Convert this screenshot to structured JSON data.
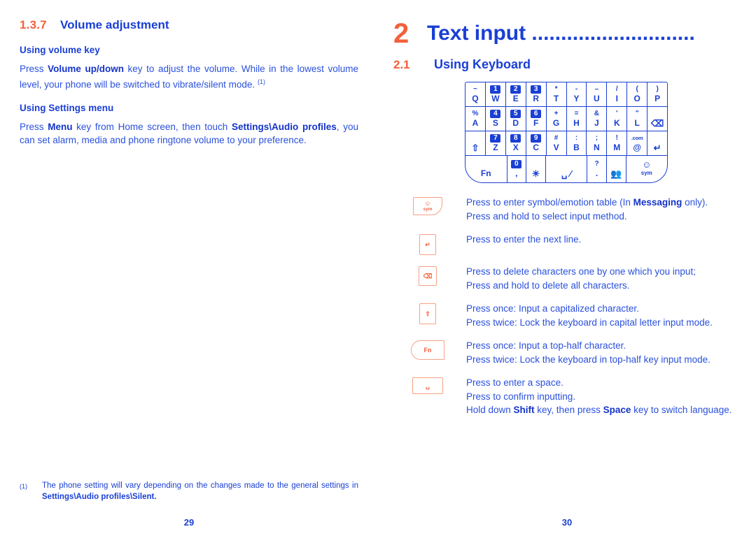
{
  "colors": {
    "blue": "#1a3fd4",
    "body_blue": "#2a50dd",
    "orange": "#f2603c",
    "icon_orange": "#f6a184"
  },
  "left_page": {
    "section": {
      "number": "1.3.7",
      "title": "Volume adjustment"
    },
    "sub1": {
      "heading": "Using volume key"
    },
    "para1": {
      "a": "Press ",
      "b1": "Volume up/down",
      "b": " key to adjust the volume. While in the lowest volume level, your phone will be switched to vibrate/silent mode. ",
      "fn": "(1)"
    },
    "sub2": {
      "heading": "Using Settings menu"
    },
    "para2": {
      "a": "Press ",
      "b1": "Menu",
      "b": " key from Home screen, then touch ",
      "b2": "Settings\\Audio profiles",
      "c": ", you can set alarm, media and phone ringtone volume to your preference."
    },
    "footnote": {
      "marker": "(1)",
      "a": "The phone setting will vary depending on the changes made to the general settings in ",
      "b": "Settings\\Audio profiles\\Silent."
    },
    "page_number": "29"
  },
  "right_page": {
    "chapter": {
      "number": "2",
      "title": "Text input ............................"
    },
    "section": {
      "number": "2.1",
      "title": "Using Keyboard"
    },
    "keyboard": {
      "rows": [
        [
          {
            "top": "~",
            "bottom": "Q",
            "num": null
          },
          {
            "top": null,
            "bottom": "W",
            "num": "1"
          },
          {
            "top": null,
            "bottom": "E",
            "num": "2"
          },
          {
            "top": null,
            "bottom": "R",
            "num": "3"
          },
          {
            "top": "*",
            "bottom": "T",
            "num": null
          },
          {
            "top": "-",
            "bottom": "Y",
            "num": null
          },
          {
            "top": "–",
            "bottom": "U",
            "num": null
          },
          {
            "top": "/",
            "bottom": "I",
            "num": null
          },
          {
            "top": "(",
            "bottom": "O",
            "num": null
          },
          {
            "top": ")",
            "bottom": "P",
            "num": null
          }
        ],
        [
          {
            "top": "%",
            "bottom": "A",
            "num": null
          },
          {
            "top": null,
            "bottom": "S",
            "num": "4"
          },
          {
            "top": null,
            "bottom": "D",
            "num": "5"
          },
          {
            "top": null,
            "bottom": "F",
            "num": "6"
          },
          {
            "top": "+",
            "bottom": "G",
            "num": null
          },
          {
            "top": "=",
            "bottom": "H",
            "num": null
          },
          {
            "top": "&",
            "bottom": "J",
            "num": null
          },
          {
            "top": "'",
            "bottom": "K",
            "num": null
          },
          {
            "top": "\"",
            "bottom": "L",
            "num": null
          },
          {
            "top": null,
            "bottom": "delete-icon",
            "num": null,
            "icon": "delete"
          }
        ],
        [
          {
            "top": null,
            "bottom": "shift-icon",
            "num": null,
            "icon": "shift"
          },
          {
            "top": null,
            "bottom": "Z",
            "num": "7"
          },
          {
            "top": null,
            "bottom": "X",
            "num": "8"
          },
          {
            "top": null,
            "bottom": "C",
            "num": "9"
          },
          {
            "top": "#",
            "bottom": "V",
            "num": null
          },
          {
            "top": ":",
            "bottom": "B",
            "num": null
          },
          {
            "top": ";",
            "bottom": "N",
            "num": null
          },
          {
            "top": "!",
            "bottom": "M",
            "num": null
          },
          {
            "top": ".com",
            "bottom": "@",
            "num": null
          },
          {
            "top": null,
            "bottom": "enter-icon",
            "num": null,
            "icon": "enter"
          }
        ],
        [
          {
            "top": null,
            "bottom": "Fn",
            "num": null,
            "wide": true
          },
          {
            "top": null,
            "bottom": ",",
            "num": "0"
          },
          {
            "top": null,
            "bottom": "lamp-icon",
            "num": null,
            "icon": "lamp"
          },
          {
            "top": null,
            "bottom": "space-icon",
            "num": null,
            "icon": "space",
            "wide": true
          },
          {
            "top": "?",
            "bottom": ".",
            "num": null
          },
          {
            "top": null,
            "bottom": "contacts-icon",
            "num": null,
            "icon": "contacts"
          },
          {
            "top": null,
            "bottom": "sym",
            "num": null,
            "icon": "sym",
            "wide": true
          }
        ]
      ]
    },
    "legend": [
      {
        "icon": "sym-key-icon",
        "icon_label_top": "☺",
        "icon_label_bottom": "sym",
        "lines": [
          {
            "a": "Press to enter symbol/emotion table (In ",
            "b": "Messaging",
            "c": " only).",
            "justify": true
          },
          {
            "a": "Press and hold to select input method.",
            "b": "",
            "c": "",
            "justify": false
          }
        ]
      },
      {
        "icon": "enter-key-icon",
        "icon_label_top": "↵",
        "icon_label_bottom": "",
        "lines": [
          {
            "a": "Press to enter the next line.",
            "b": "",
            "c": "",
            "justify": false
          }
        ]
      },
      {
        "icon": "delete-key-icon",
        "icon_label_top": "⌫",
        "icon_label_bottom": "",
        "lines": [
          {
            "a": "Press to delete characters one by one which you input;",
            "b": "",
            "c": "",
            "justify": false
          },
          {
            "a": "Press and hold to delete all characters.",
            "b": "",
            "c": "",
            "justify": false
          }
        ]
      },
      {
        "icon": "shift-key-icon",
        "icon_label_top": "⇧",
        "icon_label_bottom": "",
        "lines": [
          {
            "a": "Press once: Input a capitalized character.",
            "b": "",
            "c": "",
            "justify": false
          },
          {
            "a": "Press twice: Lock the keyboard in capital letter input mode.",
            "b": "",
            "c": "",
            "justify": true
          }
        ]
      },
      {
        "icon": "fn-key-icon",
        "icon_label_top": "Fn",
        "icon_label_bottom": "",
        "lines": [
          {
            "a": "Press once: Input a top-half character.",
            "b": "",
            "c": "",
            "justify": false
          },
          {
            "a": "Press twice: Lock the keyboard in top-half key input mode.",
            "b": "",
            "c": "",
            "justify": true
          }
        ]
      },
      {
        "icon": "space-key-icon",
        "icon_label_top": "␣",
        "icon_label_bottom": "",
        "lines": [
          {
            "a": "Press to enter a space.",
            "b": "",
            "c": "",
            "justify": false
          },
          {
            "a": "Press to confirm inputting.",
            "b": "",
            "c": "",
            "justify": false
          },
          {
            "a": "Hold down ",
            "b": "Shift",
            "c": " key, then press ",
            "d": "Space",
            "e": " key to switch language.",
            "justify": true
          }
        ]
      }
    ],
    "page_number": "30"
  }
}
